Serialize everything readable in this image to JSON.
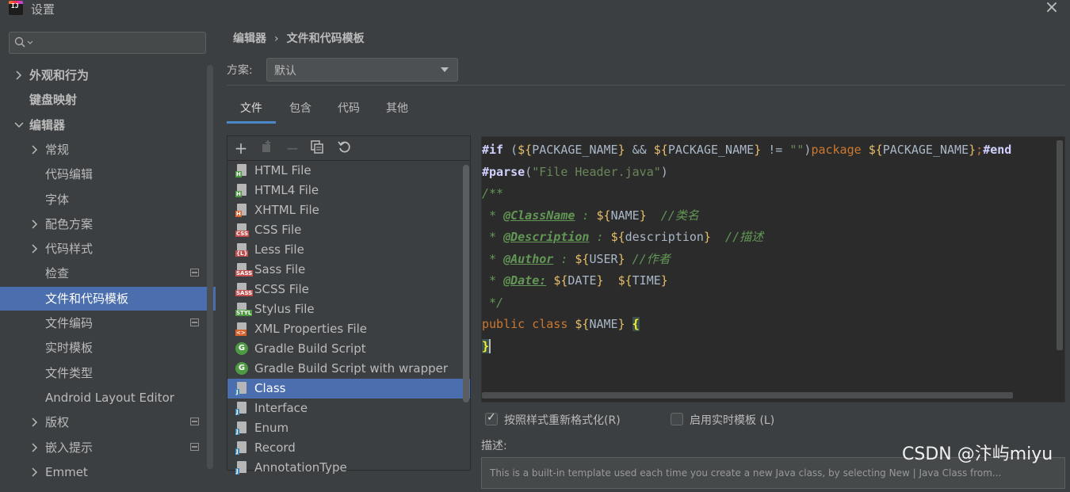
{
  "window": {
    "title": "设置"
  },
  "sidebar": {
    "search_placeholder": "",
    "items": [
      {
        "label": "外观和行为",
        "bold": true,
        "expandable": true,
        "expanded": false
      },
      {
        "label": "键盘映射",
        "bold": true,
        "expandable": false
      },
      {
        "label": "编辑器",
        "bold": true,
        "expandable": true,
        "expanded": true
      },
      {
        "label": "常规",
        "expandable": true,
        "expanded": false
      },
      {
        "label": "代码编辑"
      },
      {
        "label": "字体"
      },
      {
        "label": "配色方案",
        "expandable": true,
        "expanded": false
      },
      {
        "label": "代码样式",
        "expandable": true,
        "expanded": false
      },
      {
        "label": "检查",
        "badge": true
      },
      {
        "label": "文件和代码模板",
        "selected": true
      },
      {
        "label": "文件编码",
        "badge": true
      },
      {
        "label": "实时模板"
      },
      {
        "label": "文件类型"
      },
      {
        "label": "Android Layout Editor"
      },
      {
        "label": "版权",
        "expandable": true,
        "badge": true
      },
      {
        "label": "嵌入提示",
        "expandable": true,
        "badge": true
      },
      {
        "label": "Emmet",
        "expandable": true
      }
    ]
  },
  "breadcrumb": {
    "parent": "编辑器",
    "separator": "›",
    "current": "文件和代码模板"
  },
  "scheme": {
    "label": "方案:",
    "value": "默认"
  },
  "tabs": [
    {
      "label": "文件",
      "active": true
    },
    {
      "label": "包含"
    },
    {
      "label": "代码"
    },
    {
      "label": "其他"
    }
  ],
  "toolbar_icons": [
    "add-icon",
    "copy-add-icon",
    "remove-icon",
    "copy-icon",
    "reset-icon"
  ],
  "templates": [
    {
      "name": "HTML File",
      "icon": "html",
      "tag": "H",
      "color": "#4e9a42"
    },
    {
      "name": "HTML4 File",
      "icon": "html",
      "tag": "H",
      "color": "#4e9a42"
    },
    {
      "name": "XHTML File",
      "icon": "html",
      "tag": "H",
      "color": "#d9632b"
    },
    {
      "name": "CSS File",
      "icon": "css",
      "tag": "CSS",
      "color": "#c44d4d"
    },
    {
      "name": "Less File",
      "icon": "less",
      "tag": "{L}",
      "color": "#c44d4d"
    },
    {
      "name": "Sass File",
      "icon": "sass",
      "tag": "SASS",
      "color": "#c44d4d"
    },
    {
      "name": "SCSS File",
      "icon": "sass",
      "tag": "SASS",
      "color": "#c44d4d"
    },
    {
      "name": "Stylus File",
      "icon": "styl",
      "tag": "STYL",
      "color": "#4e9a42"
    },
    {
      "name": "XML Properties File",
      "icon": "xml",
      "tag": "<>",
      "color": "#d9632b"
    },
    {
      "name": "Gradle Build Script",
      "icon": "gradle",
      "tag": "G",
      "color": "#4e9a42"
    },
    {
      "name": "Gradle Build Script with wrapper",
      "icon": "gradle",
      "tag": "G",
      "color": "#4e9a42"
    },
    {
      "name": "Class",
      "icon": "java",
      "tag": "J",
      "color": "#3d86b8",
      "selected": true
    },
    {
      "name": "Interface",
      "icon": "java",
      "tag": "J",
      "color": "#3d86b8"
    },
    {
      "name": "Enum",
      "icon": "java",
      "tag": "J",
      "color": "#3d86b8"
    },
    {
      "name": "Record",
      "icon": "java",
      "tag": "J",
      "color": "#3d86b8"
    },
    {
      "name": "AnnotationType",
      "icon": "java",
      "tag": "J",
      "color": "#3d86b8"
    }
  ],
  "editor": {
    "lines": [
      [
        [
          "dir",
          "#if"
        ],
        [
          "var",
          " ("
        ],
        [
          "br",
          "${"
        ],
        [
          "var",
          "PACKAGE_NAME"
        ],
        [
          "br",
          "}"
        ],
        [
          "var",
          " && "
        ],
        [
          "br",
          "${"
        ],
        [
          "var",
          "PACKAGE_NAME"
        ],
        [
          "br",
          "}"
        ],
        [
          "var",
          " != "
        ],
        [
          "str",
          "\"\""
        ],
        [
          "var",
          ")"
        ],
        [
          "kw",
          "package "
        ],
        [
          "br",
          "${"
        ],
        [
          "var",
          "PACKAGE_NAME"
        ],
        [
          "br",
          "}"
        ],
        [
          "kw",
          ";"
        ],
        [
          "dir",
          "#end"
        ]
      ],
      [
        [
          "dir",
          "#parse"
        ],
        [
          "var",
          "("
        ],
        [
          "str",
          "\"File Header.java\""
        ],
        [
          "var",
          ")"
        ]
      ],
      [
        [
          "cm",
          "/**"
        ]
      ],
      [
        [
          "cm",
          " * "
        ],
        [
          "tagc",
          "@ClassName"
        ],
        [
          "cm",
          " : "
        ],
        [
          "br",
          "${"
        ],
        [
          "var",
          "NAME"
        ],
        [
          "br",
          "}"
        ],
        [
          "cm",
          "  //类名"
        ]
      ],
      [
        [
          "cm",
          " * "
        ],
        [
          "tagc",
          "@Description"
        ],
        [
          "cm",
          " : "
        ],
        [
          "br",
          "${"
        ],
        [
          "var",
          "description"
        ],
        [
          "br",
          "}"
        ],
        [
          "cm",
          "  //描述"
        ]
      ],
      [
        [
          "cm",
          " * "
        ],
        [
          "tagc",
          "@Author"
        ],
        [
          "cm",
          " : "
        ],
        [
          "br",
          "${"
        ],
        [
          "var",
          "USER"
        ],
        [
          "br",
          "}"
        ],
        [
          "cm",
          " //作者"
        ]
      ],
      [
        [
          "cm",
          " * "
        ],
        [
          "tagc",
          "@Date:"
        ],
        [
          "cm",
          " "
        ],
        [
          "br",
          "${"
        ],
        [
          "var",
          "DATE"
        ],
        [
          "br",
          "}"
        ],
        [
          "cm",
          "  "
        ],
        [
          "br",
          "${"
        ],
        [
          "var",
          "TIME"
        ],
        [
          "br",
          "}"
        ]
      ],
      [
        [
          "cm",
          " */"
        ]
      ],
      [
        [
          "kw",
          "public class "
        ],
        [
          "br",
          "${"
        ],
        [
          "var",
          "NAME"
        ],
        [
          "br",
          "}"
        ],
        [
          "var",
          " "
        ],
        [
          "hl",
          "{"
        ]
      ],
      [
        [
          "hl",
          "}"
        ],
        [
          "caret",
          ""
        ]
      ]
    ]
  },
  "options": {
    "reformat": {
      "label": "按照样式重新格式化(R)",
      "checked": true
    },
    "live_templates": {
      "label": "启用实时模板 (L)",
      "checked": false
    }
  },
  "description": {
    "label": "描述:",
    "text": "This is a built-in template used each time you create a new Java class, by selecting New | Java Class from..."
  },
  "watermark": "CSDN @汴屿miyu"
}
